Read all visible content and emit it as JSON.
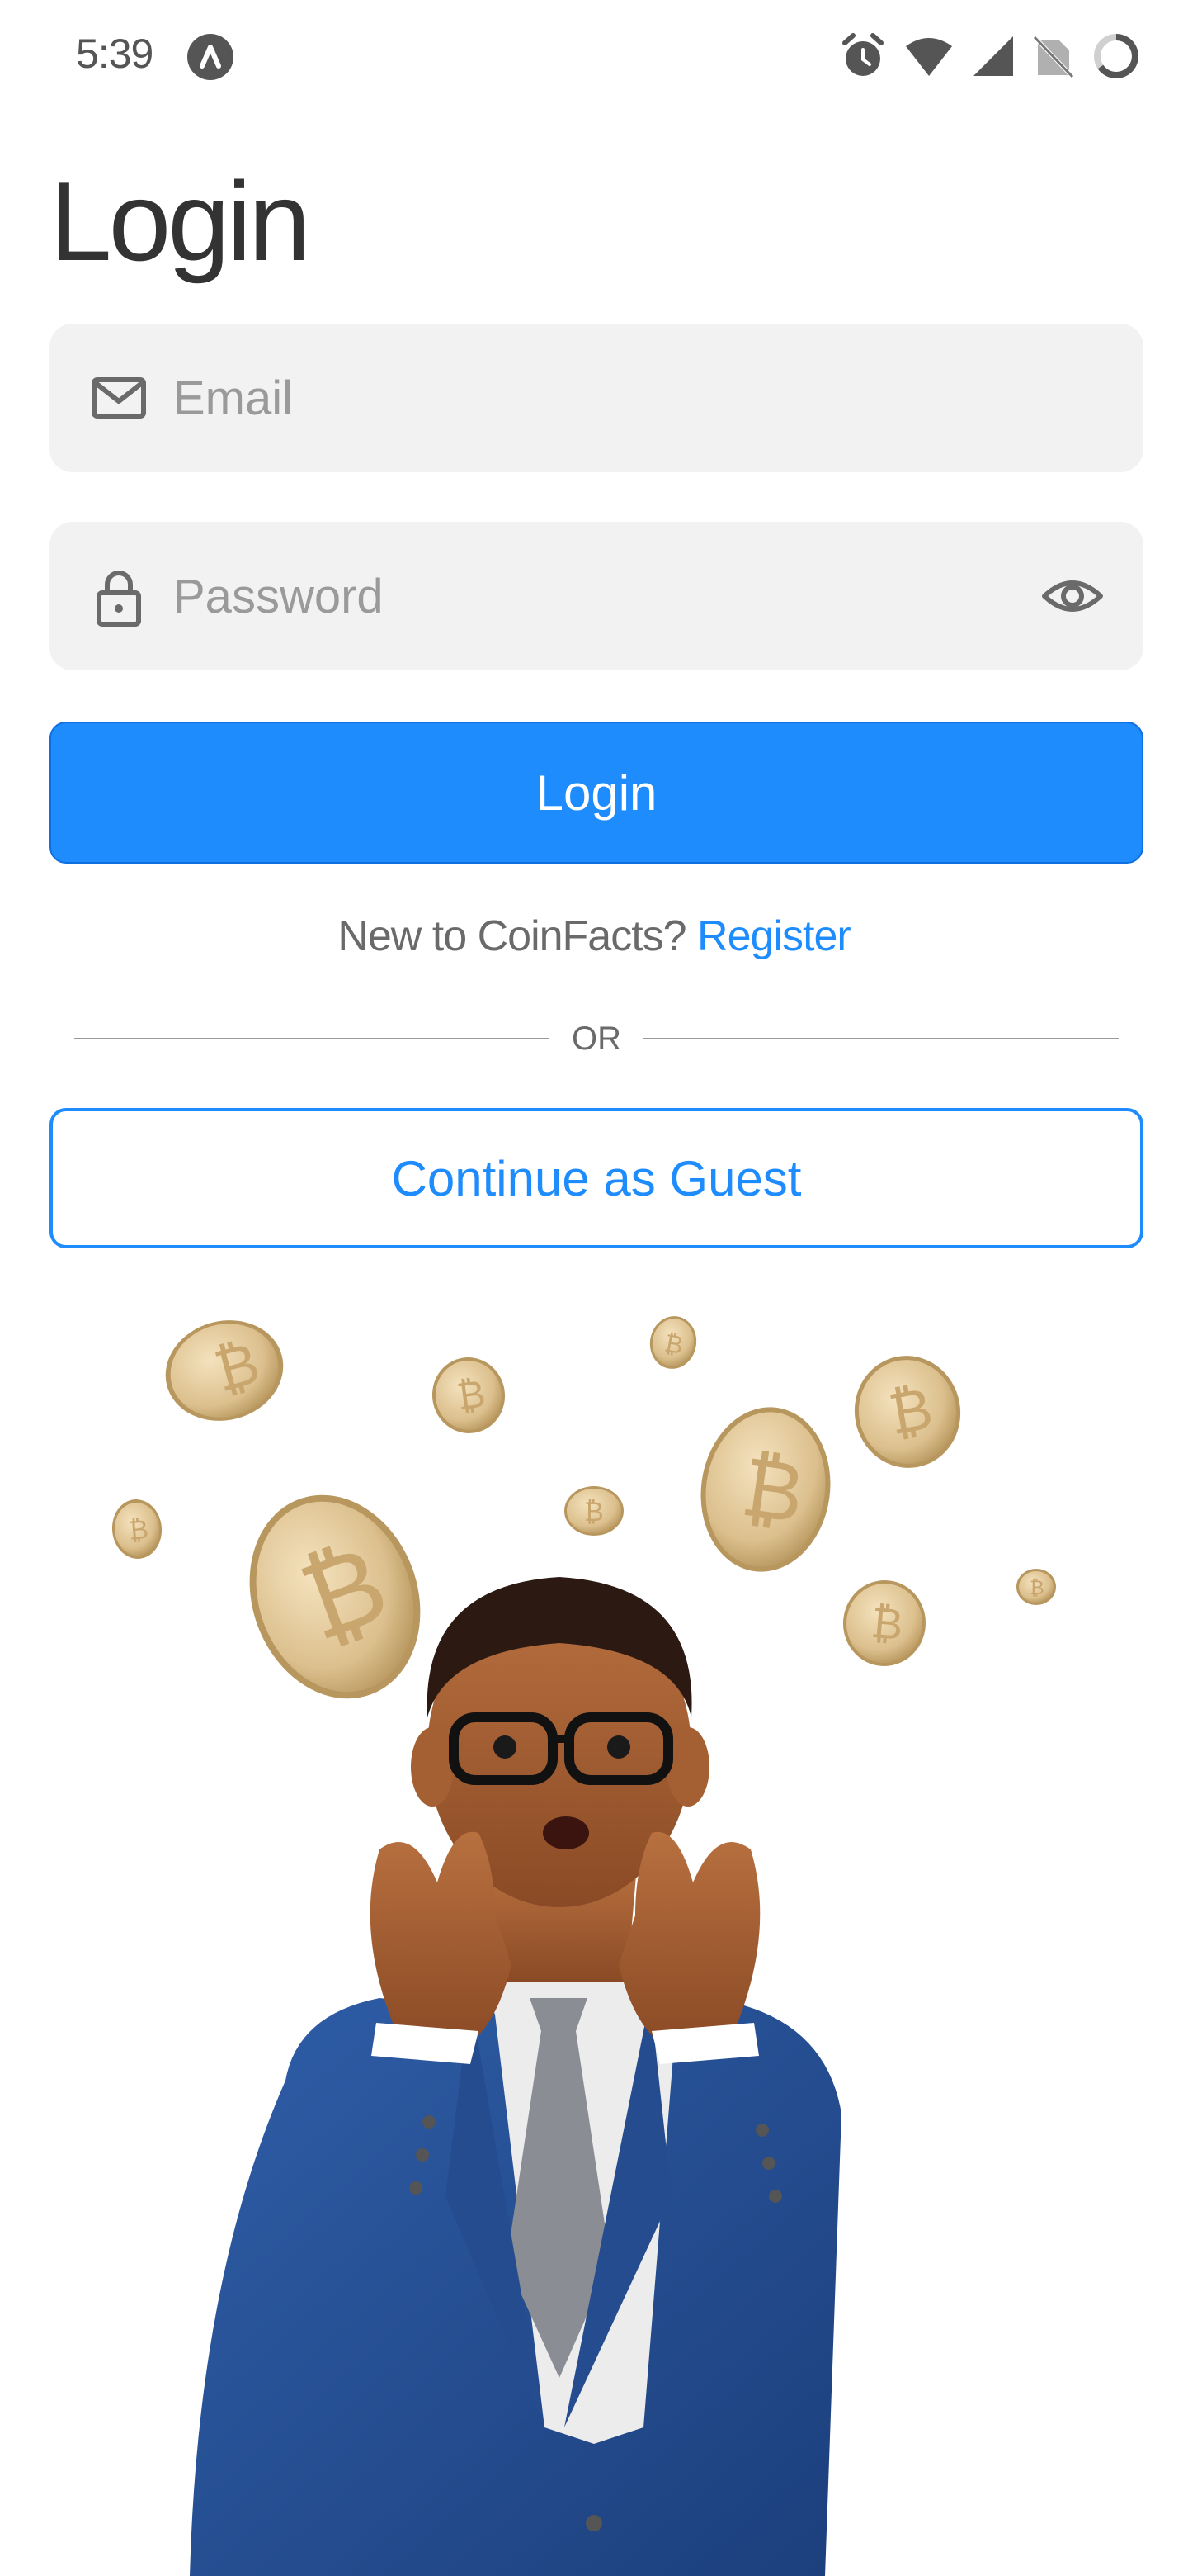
{
  "status_bar": {
    "time": "5:39"
  },
  "page": {
    "title": "Login"
  },
  "form": {
    "email_placeholder": "Email",
    "email_value": "",
    "password_placeholder": "Password",
    "password_value": "",
    "login_label": "Login"
  },
  "register": {
    "prompt": "New to CoinFacts? ",
    "link_label": "Register"
  },
  "divider": {
    "label": "OR"
  },
  "guest": {
    "label": "Continue as Guest"
  },
  "colors": {
    "accent": "#1e8cfd",
    "field_background": "#f2f2f2",
    "text": "#333333",
    "placeholder": "#9a9a9a"
  },
  "icons": {
    "email": "mail-icon",
    "password": "lock-icon",
    "visibility": "eye-icon"
  }
}
